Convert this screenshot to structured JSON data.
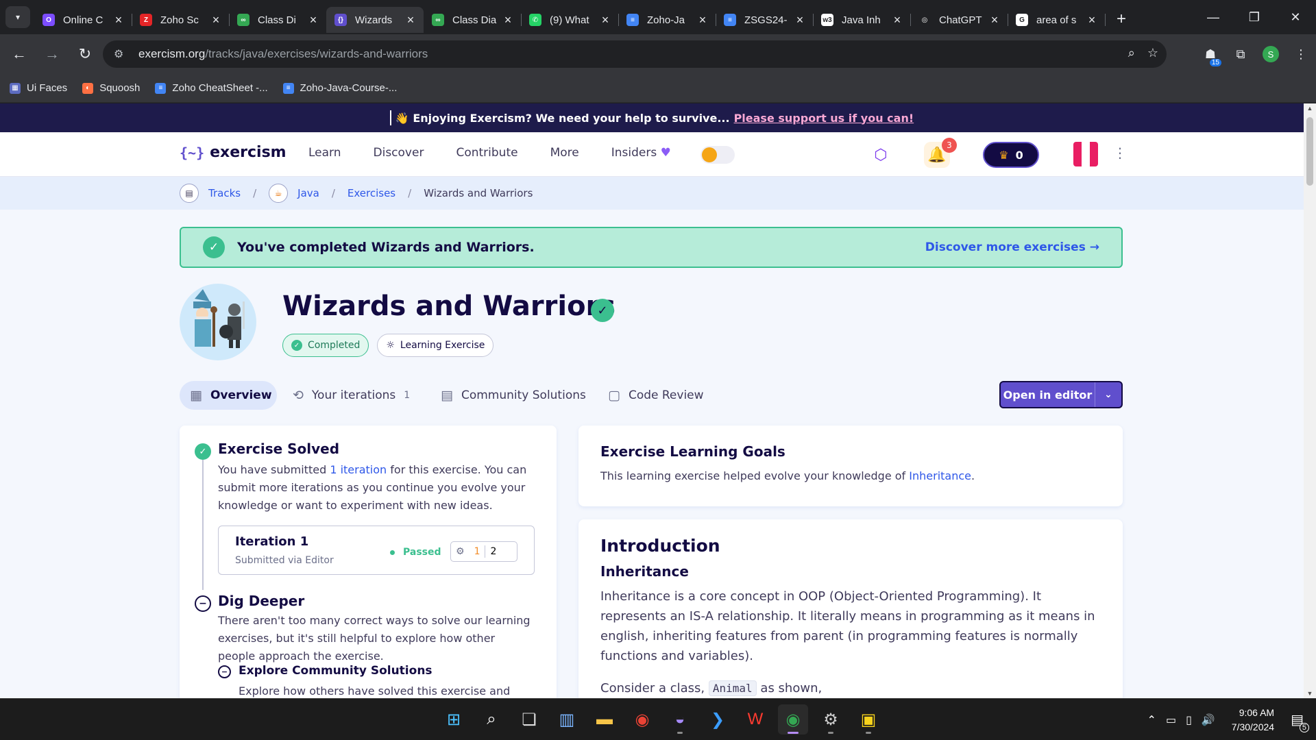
{
  "browser": {
    "tabs": [
      {
        "title": "Online C",
        "favicon": "tab-favicon-1",
        "color": "#7c4dff",
        "glyph": "O",
        "active": false
      },
      {
        "title": "Zoho Sc",
        "favicon": "tab-favicon-2",
        "color": "#e42527",
        "glyph": "Z",
        "active": false
      },
      {
        "title": "Class Di",
        "favicon": "tab-favicon-3",
        "color": "#34a853",
        "glyph": "∞",
        "active": false
      },
      {
        "title": "Wizards",
        "favicon": "tab-favicon-4",
        "color": "#604fcd",
        "glyph": "{}",
        "active": true
      },
      {
        "title": "Class Dia",
        "favicon": "tab-favicon-5",
        "color": "#34a853",
        "glyph": "∞",
        "active": false
      },
      {
        "title": "(9) What",
        "favicon": "tab-favicon-6",
        "color": "#25d366",
        "glyph": "✆",
        "active": false
      },
      {
        "title": "Zoho-Ja",
        "favicon": "tab-favicon-7",
        "color": "#4285f4",
        "glyph": "≡",
        "active": false
      },
      {
        "title": "ZSGS24-",
        "favicon": "tab-favicon-8",
        "color": "#4285f4",
        "glyph": "≡",
        "active": false
      },
      {
        "title": "Java Inh",
        "favicon": "tab-favicon-9",
        "color": "#ffffff",
        "glyph": "w3",
        "active": false
      },
      {
        "title": "ChatGPT",
        "favicon": "tab-favicon-10",
        "color": "#202124",
        "glyph": "◎",
        "active": false
      },
      {
        "title": "area of s",
        "favicon": "tab-favicon-11",
        "color": "#ffffff",
        "glyph": "G",
        "active": false
      }
    ],
    "url_host": "exercism.org",
    "url_path": "/tracks/java/exercises/wizards-and-warriors",
    "extension_badge": "15",
    "profile_initial": "S",
    "bookmarks": [
      {
        "label": "Ui Faces",
        "color": "#5c6bc0"
      },
      {
        "label": "Squoosh",
        "color": "#ff7043"
      },
      {
        "label": "Zoho CheatSheet -...",
        "color": "#4285f4"
      },
      {
        "label": "Zoho-Java-Course-...",
        "color": "#4285f4"
      }
    ]
  },
  "banner": {
    "emoji": "👋",
    "text": "Enjoying Exercism? We need your help to survive...",
    "link": "Please support us if you can!"
  },
  "nav": {
    "logo_text": "exercism",
    "links": [
      "Learn",
      "Discover",
      "Contribute",
      "More",
      "Insiders"
    ],
    "notification_count": "3",
    "reputation": "0"
  },
  "breadcrumb": {
    "items": [
      "Tracks",
      "Java",
      "Exercises",
      "Wizards and Warriors"
    ]
  },
  "completed": {
    "message": "You've completed Wizards and Warriors.",
    "link": "Discover more exercises"
  },
  "exercise": {
    "title": "Wizards and Warriors",
    "tags": [
      "Completed",
      "Learning Exercise"
    ]
  },
  "tabs": {
    "overview": "Overview",
    "iterations": "Your iterations",
    "iterations_count": "1",
    "community": "Community Solutions",
    "review": "Code Review",
    "open_editor": "Open in editor"
  },
  "left": {
    "solved_title": "Exercise Solved",
    "solved_text_pre": "You have submitted",
    "solved_link": "1 iteration",
    "solved_text_post": "for this exercise. You can submit more iterations as you continue you evolve your knowledge or want to experiment with new ideas.",
    "iteration": {
      "title": "Iteration 1",
      "subtitle": "Submitted via Editor",
      "status": "Passed",
      "warnings": "1",
      "comments": "2"
    },
    "deeper_title": "Dig Deeper",
    "deeper_text": "There aren't too many correct ways to solve our learning exercises, but it's still helpful to explore how other people approach the exercise.",
    "explore_title": "Explore Community Solutions",
    "explore_text": "Explore how others have solved this exercise and"
  },
  "goals": {
    "title": "Exercise Learning Goals",
    "text_pre": "This learning exercise helped evolve your knowledge of",
    "link": "Inheritance",
    "text_post": "."
  },
  "intro": {
    "title": "Introduction",
    "subtitle": "Inheritance",
    "paragraph": "Inheritance is a core concept in OOP (Object-Oriented Programming). It represents an IS-A relationship. It literally means in programming as it means in english, inheriting features from parent (in programming features is normally functions and variables).",
    "consider_pre": "Consider a class,",
    "consider_code": "Animal",
    "consider_post": "as shown,"
  },
  "taskbar": {
    "time": "9:06 AM",
    "date": "7/30/2024",
    "notifications": "5",
    "apps": [
      "windows-start-icon",
      "search-icon",
      "task-view-icon",
      "widgets-icon",
      "file-explorer-icon",
      "chrome-icon",
      "eclipse-icon",
      "vscode-icon",
      "wps-icon",
      "chrome-profile-icon",
      "settings-icon",
      "notes-app-icon"
    ]
  }
}
